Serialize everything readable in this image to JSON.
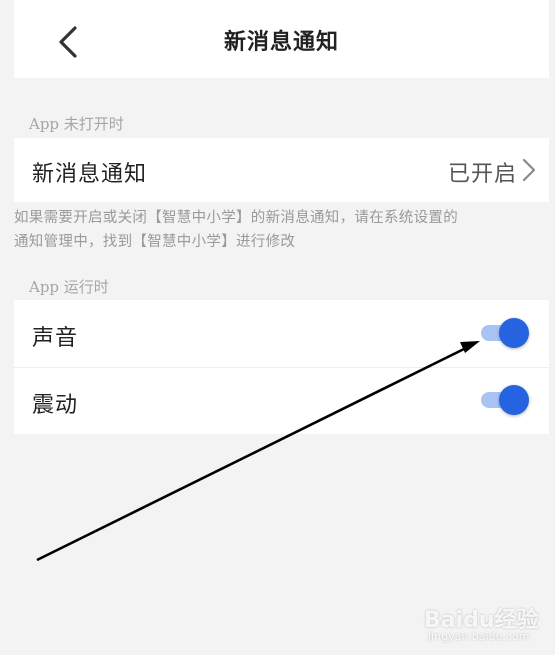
{
  "header": {
    "title": "新消息通知"
  },
  "section_app_closed": {
    "label": "App 未打开时",
    "row": {
      "title": "新消息通知",
      "value": "已开启"
    },
    "note_line1": "如果需要开启或关闭【智慧中小学】的新消息通知，请在系统设置的",
    "note_line2": "通知管理中，找到【智慧中小学】进行修改"
  },
  "section_app_running": {
    "label": "App 运行时",
    "rows": [
      {
        "title": "声音",
        "enabled": true
      },
      {
        "title": "震动",
        "enabled": true
      }
    ]
  },
  "colors": {
    "toggle_on": "#2563e0",
    "toggle_track_on": "#a9c4f4",
    "background": "#f3f3f3"
  },
  "watermark": {
    "brand": "Baidu经验",
    "url": "jingyan.baidu.com"
  },
  "icons": {
    "back": "chevron-left-icon",
    "row_arrow": "chevron-right-icon",
    "annotation": "arrow-annotation"
  }
}
